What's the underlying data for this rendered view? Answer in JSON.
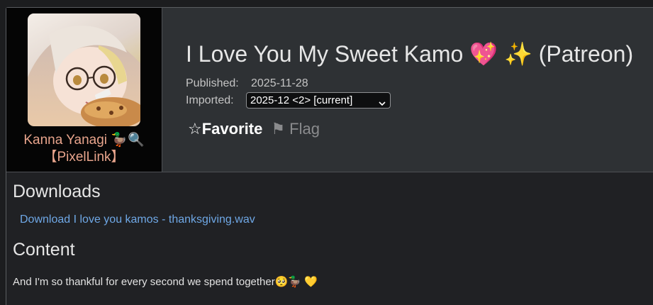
{
  "user": {
    "name": "Kanna Yanagi 🦆🔍",
    "subtitle": "【PixelLink】"
  },
  "post": {
    "title": "I Love You My Sweet Kamo 💖 ✨ (Patreon)",
    "published_label": "Published:",
    "published_value": "2025-11-28",
    "imported_label": "Imported:",
    "imported_selected": "2025-12 <2> [current]",
    "favorite_label": "☆Favorite",
    "flag_label": "⚑ Flag"
  },
  "downloads": {
    "heading": "Downloads",
    "items": [
      {
        "label": "Download I love you kamos - thanksgiving.wav"
      }
    ]
  },
  "content": {
    "heading": "Content",
    "text": "And I'm so thankful for every second we spend together🥺🦆 💛"
  },
  "colors": {
    "username": "#e8a48c",
    "link": "#6fa8e6",
    "header_bg": "#2e3134",
    "page_bg": "#202124"
  },
  "icons": {
    "dropdown": "chevron-down-icon",
    "favorite": "star-icon",
    "flag": "flag-icon"
  }
}
